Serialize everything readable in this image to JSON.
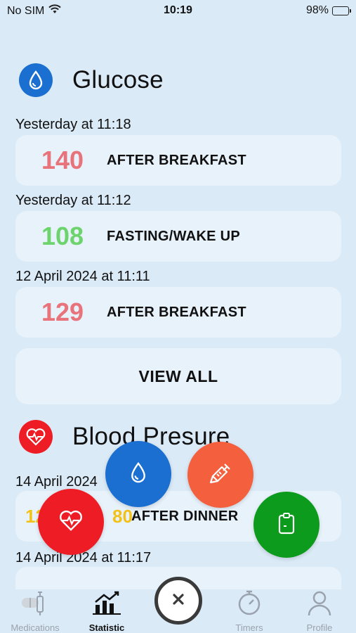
{
  "status_bar": {
    "carrier": "No SIM",
    "time": "10:19",
    "battery": "98%"
  },
  "glucose": {
    "title": "Glucose",
    "icon": "water-drop-icon",
    "entries": [
      {
        "date": "Yesterday at 11:18",
        "value": "140",
        "tag": "AFTER BREAKFAST",
        "color": "#e8737a"
      },
      {
        "date": "Yesterday at 11:12",
        "value": "108",
        "tag": "FASTING/WAKE UP",
        "color": "#6dd36d"
      },
      {
        "date": "12 April 2024 at 11:11",
        "value": "129",
        "tag": "AFTER BREAKFAST",
        "color": "#e8737a"
      }
    ],
    "view_all": "VIEW ALL"
  },
  "blood_pressure": {
    "title": "Blood Presure",
    "icon": "heart-pulse-icon",
    "entries": [
      {
        "date": "14 April 2024",
        "value_partial": "12",
        "value_suffix": "80",
        "tag": "AFTER DINNER"
      },
      {
        "date": "14 April 2024 at 11:17"
      }
    ]
  },
  "fabs": {
    "glucose_icon": "water-drop-icon",
    "medication_icon": "syringe-icon",
    "pressure_icon": "heart-pulse-icon",
    "report_icon": "clipboard-icon"
  },
  "colors": {
    "background": "#dbeaf7",
    "card": "#e8f2fb",
    "blue": "#1a6fd0",
    "red": "#ee1c25",
    "orange": "#f45f3e",
    "green": "#0c9b1c",
    "high": "#e8737a",
    "normal": "#6dd36d",
    "tab_inactive": "#9aa3ad"
  },
  "tab_bar": {
    "tabs": [
      {
        "label": "Medications",
        "active": false,
        "icon": "pills-icon"
      },
      {
        "label": "Statistic",
        "active": true,
        "icon": "chart-icon"
      },
      {
        "label": "Timers",
        "active": false,
        "icon": "stopwatch-icon"
      },
      {
        "label": "Profile",
        "active": false,
        "icon": "person-icon"
      }
    ],
    "close_icon": "close-icon"
  }
}
